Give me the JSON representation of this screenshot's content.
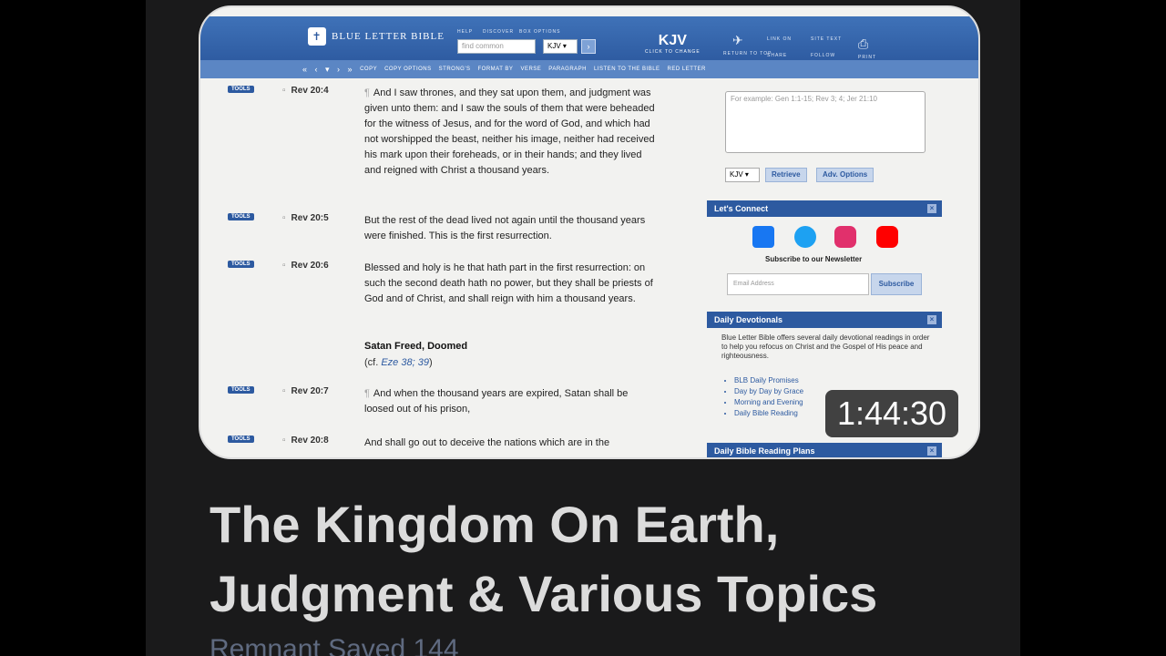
{
  "site": {
    "logo_text": "BLUE LETTER BIBLE",
    "header_links": [
      "HELP",
      "DISCOVER",
      "BOX OPTIONS"
    ],
    "search_placeholder": "find common",
    "version": "KJV",
    "version_caption": "CLICK TO CHANGE",
    "top_right": [
      "RETURN TO TOP",
      "LINK ON",
      "SITE TEXT",
      "SHARE",
      "FOLLOW",
      "PRINT"
    ],
    "nav": [
      "COPY",
      "COPY OPTIONS",
      "STRONG'S",
      "FORMAT BY",
      "VERSE",
      "PARAGRAPH",
      "LISTEN TO THE BIBLE",
      "RED LETTER"
    ]
  },
  "verses": [
    {
      "tools": "TOOLS",
      "ref": "Rev 20:4",
      "text": "And I saw thrones, and they sat upon them, and judgment was given unto them: and I saw the souls of them that were beheaded for the witness of Jesus, and for the word of God, and which had not worshipped the beast, neither his image, neither had received his mark upon their foreheads, or in their hands; and they lived and reigned with Christ a thousand years."
    },
    {
      "tools": "TOOLS",
      "ref": "Rev 20:5",
      "text": "But the rest of the dead lived not again until the thousand years were finished. This is the first resurrection."
    },
    {
      "tools": "TOOLS",
      "ref": "Rev 20:6",
      "text": "Blessed and holy is he that hath part in the first resurrection: on such the second death hath no power, but they shall be priests of God and of Christ, and shall reign with him a thousand years."
    },
    {
      "tools": "TOOLS",
      "ref": "Rev 20:7",
      "text": "And when the thousand years are expired, Satan shall be loosed out of his prison,"
    },
    {
      "tools": "TOOLS",
      "ref": "Rev 20:8",
      "text": "And shall go out to deceive the nations which are in the"
    }
  ],
  "section": {
    "heading": "Satan Freed, Doomed",
    "xref_prefix": "(cf.",
    "xref_links": "Eze 38; 39",
    "xref_suffix": ")"
  },
  "sidebar": {
    "passage_placeholder": "For example: Gen 1:1-15; Rev 3; 4; Jer 21:10",
    "version": "KJV",
    "retrieve": "Retrieve",
    "adv_options": "Adv. Options",
    "connect_title": "Let's Connect",
    "newsletter": "Subscribe to our Newsletter",
    "email_placeholder": "Email Address",
    "subscribe": "Subscribe",
    "devotionals_title": "Daily Devotionals",
    "devotionals_text": "Blue Letter Bible offers several daily devotional readings in order to help you refocus on Christ and the Gospel of His peace and righteousness.",
    "devotional_links": [
      "BLB Daily Promises",
      "Day by Day by Grace",
      "Morning and Evening",
      "Daily Bible Reading"
    ],
    "plans_title": "Daily Bible Reading Plans"
  },
  "video": {
    "duration": "1:44:30",
    "title": "The Kingdom On Earth, Judgment & Various Topics",
    "channel": "Remnant Saved 144"
  },
  "colors": {
    "blb_blue": "#2d5aa0",
    "facebook": "#1877f2",
    "twitter": "#1da1f2",
    "instagram": "#e1306c",
    "youtube": "#ff0000"
  }
}
